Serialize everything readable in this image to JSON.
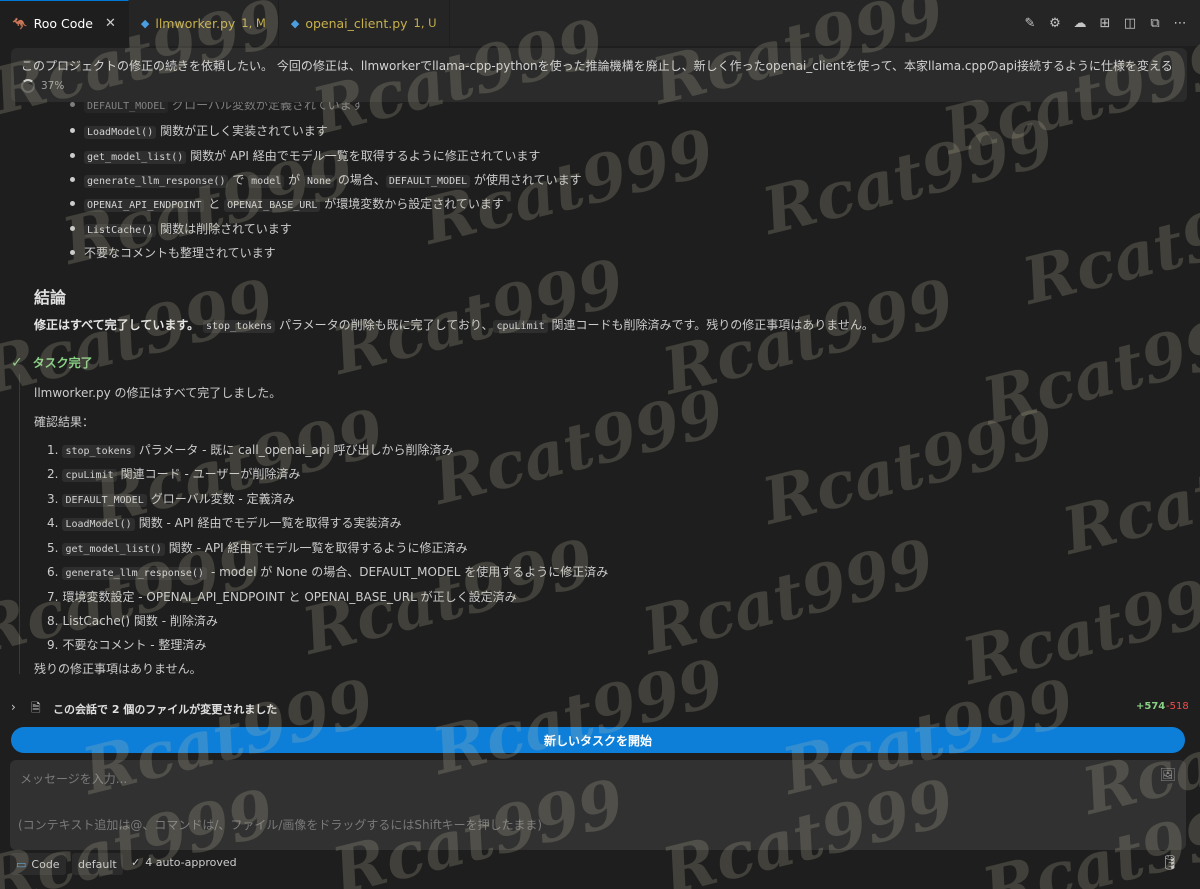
{
  "tabs": [
    {
      "label": "Roo Code",
      "suffix": "",
      "active": true
    },
    {
      "label": "llmworker.py",
      "suffix": "1, M",
      "active": false
    },
    {
      "label": "openai_client.py",
      "suffix": "1, U",
      "active": false
    }
  ],
  "task": {
    "text": "このプロジェクトの修正の続きを依頼したい。 今回の修正は、llmworkerでllama-cpp-pythonを使った推論機構を廃止し、新しく作ったopenai_clientを使って、本家llama.cppのapi接続するように仕様を変える",
    "progress": "37%"
  },
  "checklist": {
    "partial": [
      "DEFAULT_MODEL",
      "グローバル変数が定義されています"
    ],
    "items": [
      {
        "code": "LoadModel()",
        "text": "関数が正しく実装されています"
      },
      {
        "code": "get_model_list()",
        "text": "関数が API 経由でモデル一覧を取得するように修正されています"
      },
      {
        "code": "generate_llm_response()",
        "t1": "で",
        "code2": "model",
        "t2": "が",
        "code3": "None",
        "t3": "の場合、",
        "code4": "DEFAULT_MODEL",
        "t4": "が使用されています"
      },
      {
        "code": "OPENAI_API_ENDPOINT",
        "t1": "と",
        "code2": "OPENAI_BASE_URL",
        "t2": "が環境変数から設定されています"
      },
      {
        "code": "ListCache()",
        "text": "関数は削除されています"
      },
      {
        "text": "不要なコメントも整理されています"
      }
    ]
  },
  "conclusion": {
    "heading": "結論",
    "bold": "修正はすべて完了しています。",
    "code1": "stop_tokens",
    "t1": "パラメータの削除も既に完了しており、",
    "code2": "cpuLimit",
    "t2": "関連コードも削除済みです。残りの修正事項はありません。"
  },
  "completion": {
    "title": "タスク完了",
    "summary": "llmworker.py の修正はすべて完了しました。",
    "results_label": "確認結果：",
    "results": [
      {
        "n": "1.",
        "code": "stop_tokens",
        "text": "パラメータ - 既に call_openai_api 呼び出しから削除済み"
      },
      {
        "n": "2.",
        "code": "cpuLimit",
        "text": "関連コード - ユーザーが削除済み"
      },
      {
        "n": "3.",
        "code": "DEFAULT_MODEL",
        "text": "グローバル変数 - 定義済み"
      },
      {
        "n": "4.",
        "code": "LoadModel()",
        "text": "関数 - API 経由でモデル一覧を取得する実装済み"
      },
      {
        "n": "5.",
        "code": "get_model_list()",
        "text": "関数 - API 経由でモデル一覧を取得するように修正済み"
      },
      {
        "n": "6.",
        "code": "generate_llm_response()",
        "text": "- model が None の場合、DEFAULT_MODEL を使用するように修正済み"
      },
      {
        "n": "7.",
        "code": "",
        "text": "環境変数設定 - OPENAI_API_ENDPOINT と OPENAI_BASE_URL が正しく設定済み"
      },
      {
        "n": "8.",
        "code": "",
        "text": "ListCache() 関数 - 削除済み"
      },
      {
        "n": "9.",
        "code": "",
        "text": "不要なコメント - 整理済み"
      }
    ],
    "footer": "残りの修正事項はありません。"
  },
  "files": {
    "label": "この会話で 2 個のファイルが変更されました",
    "added": "+574",
    "removed": "-518"
  },
  "new_task_label": "新しいタスクを開始",
  "input": {
    "placeholder": "メッセージを入力...",
    "hint": "(コンテキスト追加は@、コマンドは/、ファイル/画像をドラッグするにはShiftキーを押したまま)"
  },
  "bottom": {
    "mode": "Code",
    "profile": "default",
    "auto_approved": "4 auto-approved"
  },
  "watermark": "Rcat999"
}
